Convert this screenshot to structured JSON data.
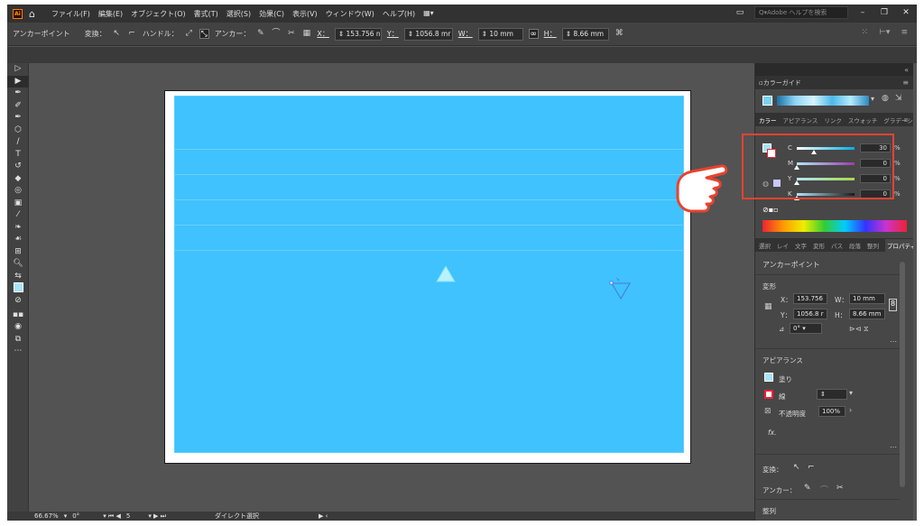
{
  "menubar": {
    "logo": "Ai",
    "items": [
      "ファイル(F)",
      "編集(E)",
      "オブジェクト(O)",
      "書式(T)",
      "選択(S)",
      "効果(C)",
      "表示(V)",
      "ウィンドウ(W)",
      "ヘルプ(H)"
    ],
    "search_placeholder": "Adobe ヘルプを検索"
  },
  "control_bar": {
    "mode_label": "アンカーポイント",
    "convert_label": "変換：",
    "handle_label": "ハンドル：",
    "anchor_label": "アンカー：",
    "x_label": "X：",
    "x_value": "153.756 n",
    "y_label": "Y：",
    "y_value": "1056.8 mr",
    "w_label": "W：",
    "w_value": "10 mm",
    "h_label": "H：",
    "h_value": "8.66 mm"
  },
  "status_bar": {
    "zoom": "66.67%",
    "rotation": "0°",
    "artboard": "5",
    "tool": "ダイレクト選択"
  },
  "panel": {
    "color_guide_title": "カラーガイド",
    "tabs": [
      "カラー",
      "アピアランス",
      "リンク",
      "スウォッチ",
      "グラデーション"
    ],
    "cmyk": [
      {
        "label": "C",
        "value": "30",
        "unit": "%"
      },
      {
        "label": "M",
        "value": "0",
        "unit": "%"
      },
      {
        "label": "Y",
        "value": "0",
        "unit": "%"
      },
      {
        "label": "K",
        "value": "0",
        "unit": "%"
      }
    ],
    "lower_tabs": [
      "選択",
      "レイ",
      "文字",
      "変形",
      "パス",
      "段落",
      "整列",
      "プロパティ"
    ],
    "properties": {
      "header": "アンカーポイント",
      "transform_label": "変形",
      "x_label": "X：",
      "x_value": "153.756",
      "w_label": "W：",
      "w_value": "10 mm",
      "y_label": "Y：",
      "y_value": "1056.8 r",
      "h_label": "H：",
      "h_value": "8.66 mm",
      "angle_value": "0°",
      "appearance_label": "アピアランス",
      "fill_label": "塗り",
      "stroke_label": "線",
      "opacity_label": "不透明度",
      "opacity_value": "100%",
      "fx_label": "fx.",
      "convert_label": "変換：",
      "anchor_label": "アンカー：",
      "align_label": "整列"
    }
  },
  "colors": {
    "artwork_fill": "#3fc2fd",
    "highlight_box": "#e8432f",
    "cursor_hand": "#e8432f"
  }
}
